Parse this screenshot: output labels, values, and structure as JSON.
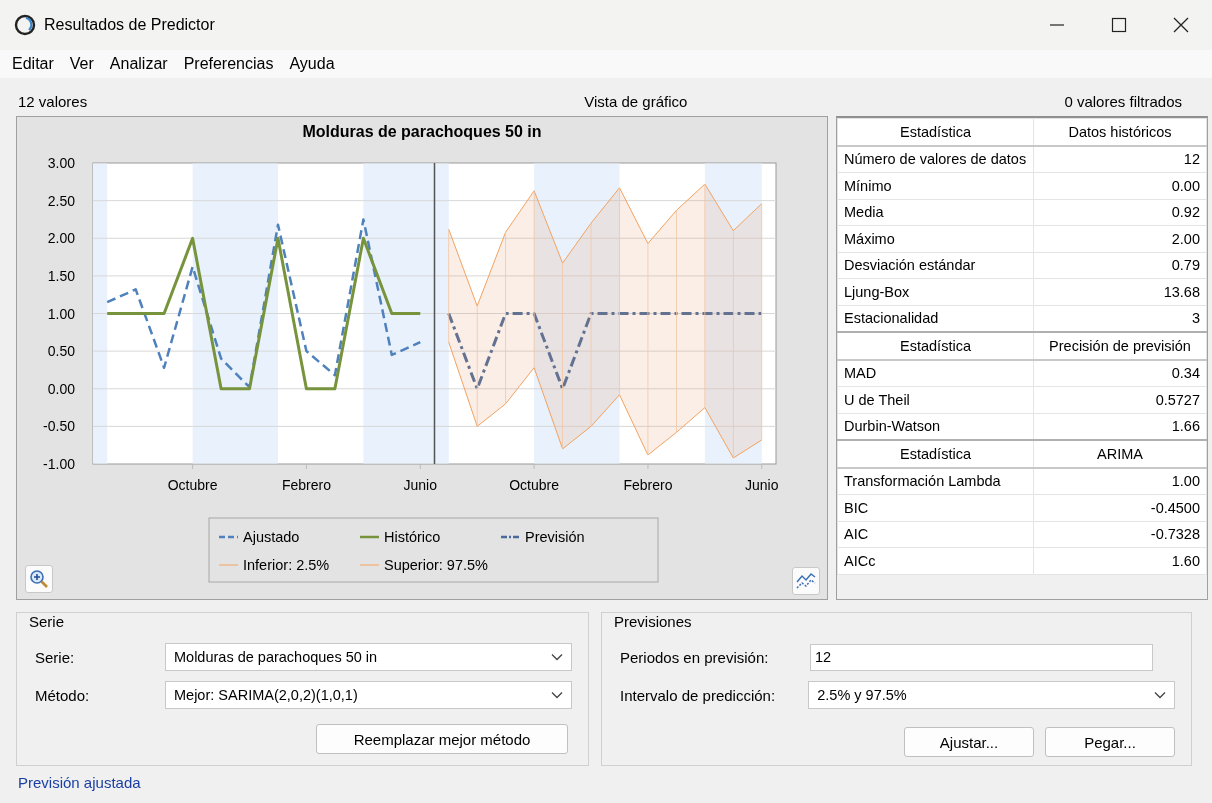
{
  "window": {
    "title": "Resultados de Predictor"
  },
  "menu": [
    "Editar",
    "Ver",
    "Analizar",
    "Preferencias",
    "Ayuda"
  ],
  "header": {
    "left": "12 valores",
    "center": "Vista de gráfico",
    "right": "0 valores filtrados"
  },
  "chart": {
    "chart_data": {
      "type": "line",
      "title": "Molduras de parachoques 50 in",
      "categories": [
        null,
        null,
        null,
        "Octubre",
        null,
        null,
        null,
        "Febrero",
        null,
        null,
        null,
        "Junio",
        null,
        null,
        null,
        "Octubre",
        null,
        null,
        null,
        "Febrero",
        null,
        null,
        null,
        "Junio"
      ],
      "ylim": [
        -1,
        3
      ],
      "grid": true,
      "legend": true,
      "yticks": [
        {
          "value": 3,
          "label": "3.00"
        },
        {
          "value": 2.5,
          "label": "2.50"
        },
        {
          "value": 2,
          "label": "2.00"
        },
        {
          "value": 1.5,
          "label": "1.50"
        },
        {
          "value": 1,
          "label": "1.00"
        },
        {
          "value": 0.5,
          "label": "0.50"
        },
        {
          "value": 0,
          "label": "0.00"
        },
        {
          "value": -0.5,
          "label": "-0.50"
        },
        {
          "value": -1,
          "label": "-1.00"
        }
      ],
      "series": [
        {
          "name": "Ajustado",
          "color": "#4f81bd",
          "line_style": "dashed",
          "values": [
            1.15,
            1.32,
            0.28,
            1.62,
            0.4,
            0.02,
            2.18,
            0.5,
            0.18,
            2.25,
            0.45,
            0.62,
            null,
            null,
            null,
            null,
            null,
            null,
            null,
            null,
            null,
            null,
            null,
            null
          ]
        },
        {
          "name": "Histórico",
          "color": "#77933c",
          "line_style": "solid",
          "values": [
            1,
            1,
            1,
            2,
            0,
            0,
            2,
            0,
            0,
            2,
            1,
            1,
            null,
            null,
            null,
            null,
            null,
            null,
            null,
            null,
            null,
            null,
            null,
            null
          ]
        },
        {
          "name": "Previsión",
          "color": "#4a6a9a",
          "line_style": "dashdot",
          "values": [
            null,
            null,
            null,
            null,
            null,
            null,
            null,
            null,
            null,
            null,
            null,
            null,
            1,
            0,
            1,
            1,
            0,
            1,
            1,
            1,
            1,
            1,
            1,
            1
          ]
        },
        {
          "name": "Inferior: 2.5%",
          "color": "#f4a460",
          "line_style": "solid",
          "values": [
            null,
            null,
            null,
            null,
            null,
            null,
            null,
            null,
            null,
            null,
            null,
            null,
            0.62,
            -0.5,
            -0.2,
            0.28,
            -0.8,
            -0.5,
            -0.08,
            -0.88,
            -0.58,
            -0.25,
            -0.92,
            -0.68
          ]
        },
        {
          "name": "Superior: 97.5%",
          "color": "#f4a460",
          "line_style": "solid",
          "values": [
            null,
            null,
            null,
            null,
            null,
            null,
            null,
            null,
            null,
            null,
            null,
            null,
            2.12,
            1.1,
            2.08,
            2.63,
            1.67,
            2.2,
            2.67,
            1.93,
            2.37,
            2.72,
            2.1,
            2.46
          ]
        }
      ]
    }
  },
  "stats_tables": [
    {
      "columns": [
        "Estadística",
        "Datos históricos"
      ],
      "rows": [
        [
          "Número de valores de datos",
          "12"
        ],
        [
          "Mínimo",
          "0.00"
        ],
        [
          "Media",
          "0.92"
        ],
        [
          "Máximo",
          "2.00"
        ],
        [
          "Desviación estándar",
          "0.79"
        ],
        [
          "Ljung-Box",
          "13.68"
        ],
        [
          "Estacionalidad",
          "3"
        ]
      ]
    },
    {
      "columns": [
        "Estadística",
        "Precisión de previsión"
      ],
      "rows": [
        [
          "MAD",
          "0.34"
        ],
        [
          "U de Theil",
          "0.5727"
        ],
        [
          "Durbin-Watson",
          "1.66"
        ]
      ]
    },
    {
      "columns": [
        "Estadística",
        "ARIMA"
      ],
      "rows": [
        [
          "Transformación Lambda",
          "1.00"
        ],
        [
          "BIC",
          "-0.4500"
        ],
        [
          "AIC",
          "-0.7328"
        ],
        [
          "AICc",
          "1.60"
        ]
      ]
    }
  ],
  "serie_group": {
    "title": "Serie",
    "fields": [
      {
        "label": "Serie:",
        "value": "Molduras de parachoques 50 in",
        "kind": "dropdown"
      },
      {
        "label": "Método:",
        "value": "Mejor: SARIMA(2,0,2)(1,0,1)",
        "kind": "dropdown"
      }
    ],
    "buttons": [
      "Reemplazar mejor método"
    ]
  },
  "previsiones_group": {
    "title": "Previsiones",
    "fields": [
      {
        "label": "Periodos en previsión:",
        "value": "12",
        "kind": "text"
      },
      {
        "label": "Intervalo de predicción:",
        "value": "2.5% y 97.5%",
        "kind": "dropdown"
      }
    ],
    "buttons": [
      "Ajustar...",
      "Pegar..."
    ]
  },
  "status_bar": {
    "text": "Previsión ajustada"
  }
}
